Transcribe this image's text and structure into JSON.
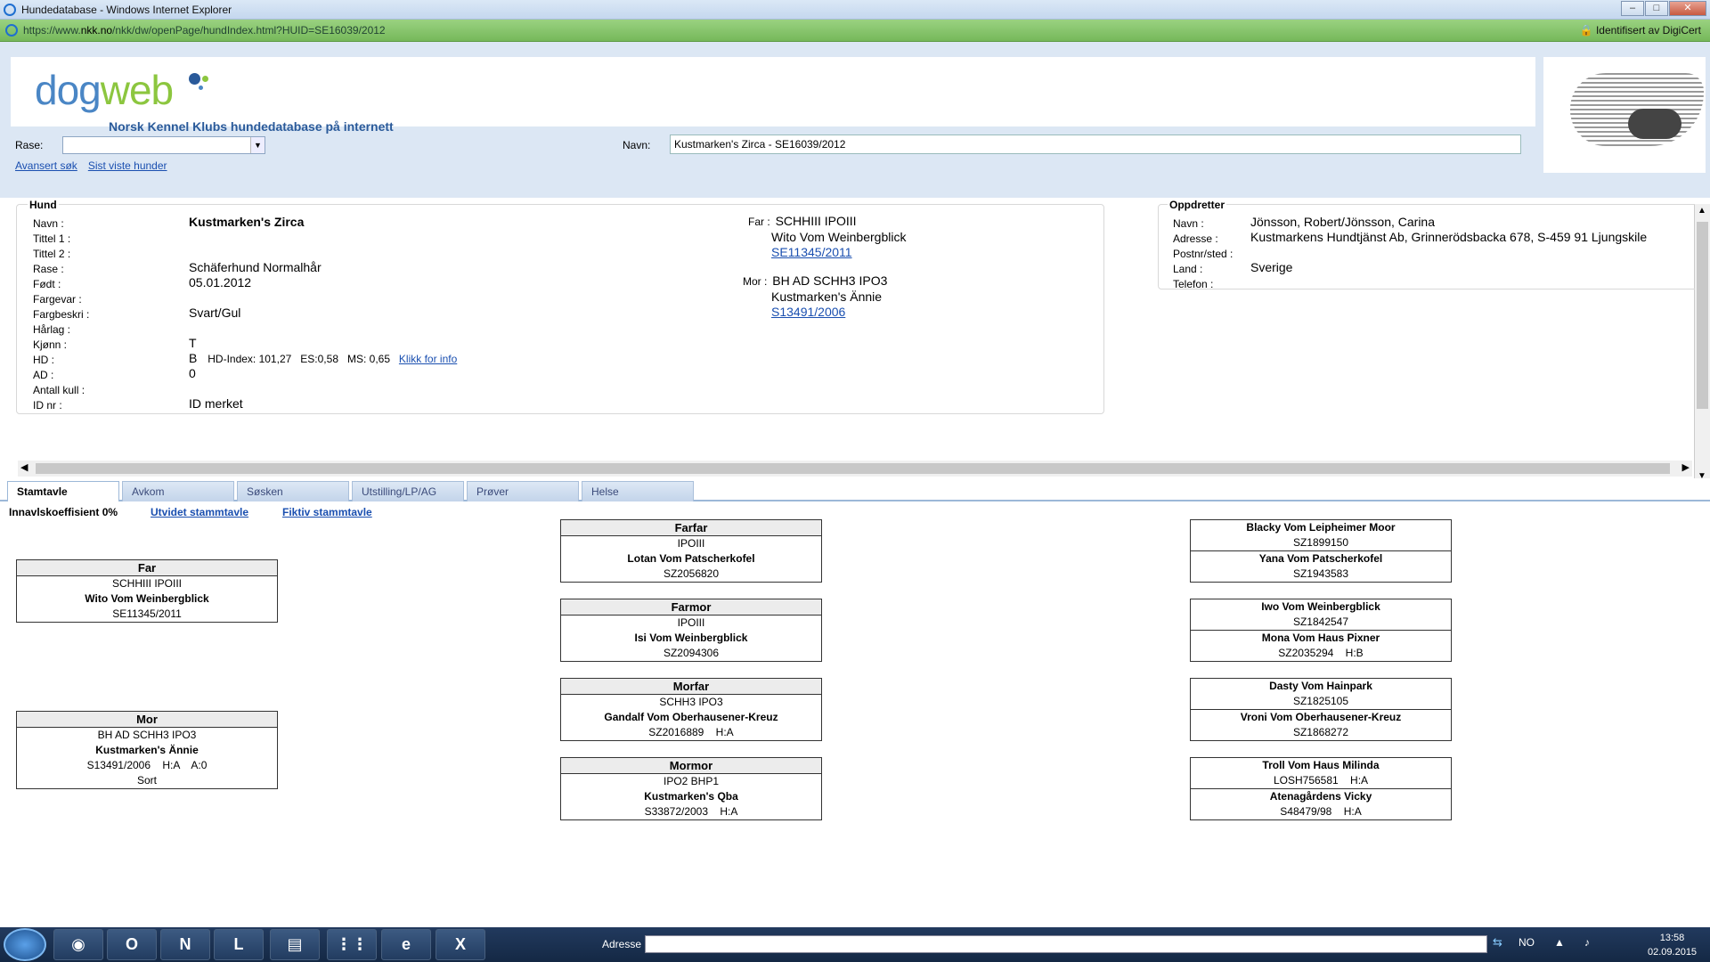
{
  "window": {
    "title": "Hundedatabase - Windows Internet Explorer"
  },
  "addressbar": {
    "url_prefix": "https://www.",
    "url_domain": "nkk.no",
    "url_rest": "/nkk/dw/openPage/hundIndex.html?HUID=SE16039/2012",
    "identity": "Identifisert av DigiCert"
  },
  "header": {
    "logo_dog": "dog",
    "logo_web": "web",
    "tagline": "Norsk Kennel Klubs hundedatabase på internett"
  },
  "search": {
    "rase_label": "Rase:",
    "rase_value": "",
    "navn_label": "Navn:",
    "navn_value": "Kustmarken's Zirca - SE16039/2012",
    "advanced_link": "Avansert søk",
    "recent_link": "Sist viste hunder"
  },
  "hund": {
    "section_title": "Hund",
    "labels": {
      "navn": "Navn :",
      "tittel1": "Tittel 1 :",
      "tittel2": "Tittel 2 :",
      "rase": "Rase :",
      "fodt": "Født :",
      "fargevar": "Fargevar :",
      "fargebeskri": "Fargbeskri :",
      "harlag": "Hårlag :",
      "kjonn": "Kjønn :",
      "hd": "HD :",
      "ad": "AD :",
      "antall_kull": "Antall kull :",
      "id_nr": "ID nr :"
    },
    "values": {
      "navn": "Kustmarken's Zirca",
      "rase": "Schäferhund Normalhår",
      "fodt": "05.01.2012",
      "fargebeskri": "Svart/Gul",
      "kjonn": "T",
      "hd": "B",
      "hd_extra": "HD-Index: 101,27   ES:0,58   MS: 0,65",
      "hd_link": "Klikk for info",
      "ad": "0",
      "id_nr": "ID merket"
    },
    "far": {
      "label": "Far :",
      "titles": "SCHHIII IPOIII",
      "name": "Wito Vom Weinbergblick",
      "reg": "SE11345/2011"
    },
    "mor": {
      "label": "Mor :",
      "titles": "BH AD SCHH3 IPO3",
      "name": "Kustmarken's Ännie",
      "reg": "S13491/2006"
    }
  },
  "oppdretter": {
    "section_title": "Oppdretter",
    "labels": {
      "navn": "Navn :",
      "adresse": "Adresse :",
      "postnr": "Postnr/sted :",
      "land": "Land :",
      "telefon": "Telefon :"
    },
    "values": {
      "navn": "Jönsson, Robert/Jönsson, Carina",
      "adresse": "Kustmarkens Hundtjänst Ab, Grinnerödsbacka 678, S-459 91 Ljungskile",
      "land": "Sverige"
    }
  },
  "tabs": [
    "Stamtavle",
    "Avkom",
    "Søsken",
    "Utstilling/LP/AG",
    "Prøver",
    "Helse"
  ],
  "pedigree": {
    "coef": "Innavlskoeffisient 0%",
    "link_extended": "Utvidet stammtavle",
    "link_fictive": "Fiktiv stammtavle",
    "far": {
      "head": "Far",
      "titles": "SCHHIII IPOIII",
      "name": "Wito Vom Weinbergblick",
      "reg": "SE11345/2011"
    },
    "mor": {
      "head": "Mor",
      "titles": "BH AD SCHH3 IPO3",
      "name": "Kustmarken's Ännie",
      "reg": "S13491/2006    H:A    A:0",
      "color": "Sort"
    },
    "farfar": {
      "head": "Farfar",
      "titles": "IPOIII",
      "name": "Lotan Vom Patscherkofel",
      "reg": "SZ2056820"
    },
    "farmor": {
      "head": "Farmor",
      "titles": "IPOIII",
      "name": "Isi Vom Weinbergblick",
      "reg": "SZ2094306"
    },
    "morfar": {
      "head": "Morfar",
      "titles": "SCHH3 IPO3",
      "name": "Gandalf Vom Oberhausener-Kreuz",
      "reg": "SZ2016889    H:A"
    },
    "mormor": {
      "head": "Mormor",
      "titles": "IPO2 BHP1",
      "name": "Kustmarken's Qba",
      "reg": "S33872/2003    H:A"
    },
    "gen3": [
      {
        "name1": "Blacky Vom Leipheimer Moor",
        "reg1": "SZ1899150",
        "name2": "Yana Vom Patscherkofel",
        "reg2": "SZ1943583"
      },
      {
        "name1": "Iwo Vom Weinbergblick",
        "reg1": "SZ1842547",
        "name2": "Mona Vom Haus Pixner",
        "reg2": "SZ2035294    H:B"
      },
      {
        "name1": "Dasty Vom Hainpark",
        "reg1": "SZ1825105",
        "name2": "Vroni Vom Oberhausener-Kreuz",
        "reg2": "SZ1868272"
      },
      {
        "name1": "Troll Vom Haus Milinda",
        "reg1": "LOSH756581    H:A",
        "name2": "Atenagårdens Vicky",
        "reg2": "S48479/98    H:A"
      }
    ]
  },
  "taskbar": {
    "adresse_label": "Adresse",
    "lang": "NO",
    "time": "13:58",
    "date": "02.09.2015"
  }
}
